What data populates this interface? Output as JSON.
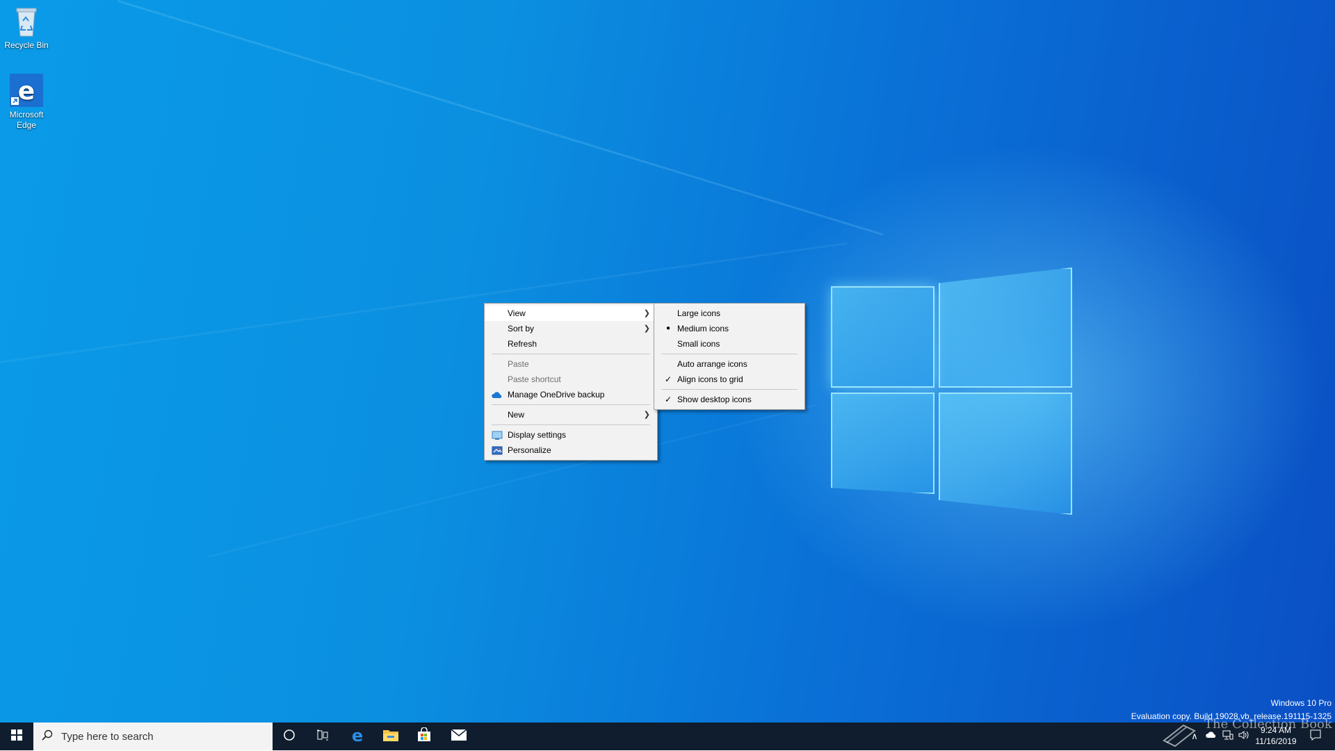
{
  "desktop": {
    "icons": [
      {
        "label": "Recycle Bin",
        "icon": "recycle-bin-icon"
      },
      {
        "label": "Microsoft Edge",
        "icon": "edge-icon"
      }
    ]
  },
  "context_menu": {
    "items": [
      {
        "label": "View",
        "submenu": true,
        "highlighted": true
      },
      {
        "label": "Sort by",
        "submenu": true
      },
      {
        "label": "Refresh"
      },
      {
        "label": "Paste",
        "disabled": true
      },
      {
        "label": "Paste shortcut",
        "disabled": true
      },
      {
        "label": "Manage OneDrive backup",
        "icon": "onedrive-icon"
      },
      {
        "label": "New",
        "submenu": true
      },
      {
        "label": "Display settings",
        "icon": "display-settings-icon"
      },
      {
        "label": "Personalize",
        "icon": "personalize-icon"
      }
    ]
  },
  "view_submenu": {
    "items": [
      {
        "label": "Large icons"
      },
      {
        "label": "Medium icons",
        "selected": true
      },
      {
        "label": "Small icons"
      },
      {
        "label": "Auto arrange icons",
        "checked": false
      },
      {
        "label": "Align icons to grid",
        "checked": true
      },
      {
        "label": "Show desktop icons",
        "checked": true
      }
    ]
  },
  "watermark": {
    "line1": "Windows 10 Pro",
    "line2": "Evaluation copy. Build 19028.vb_release.191115-1325"
  },
  "taskbar": {
    "search_placeholder": "Type here to search",
    "pinned": [
      "edge-icon",
      "file-explorer-icon",
      "store-icon",
      "mail-icon"
    ],
    "clock_time": "9:24 AM",
    "clock_date": "11/16/2019",
    "overlay_text": "The Collection Book"
  },
  "colors": {
    "desktop_blue": "#0a8fe0",
    "taskbar": "#0f1d2e",
    "menu_bg": "#f2f2f2"
  }
}
